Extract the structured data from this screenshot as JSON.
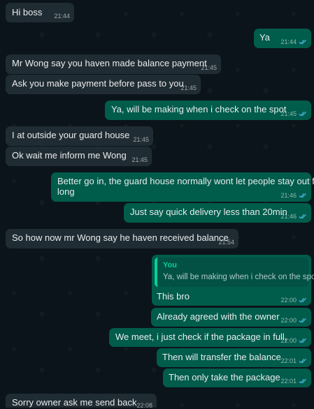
{
  "chat": {
    "messages": [
      {
        "dir": "in",
        "text": "Hi boss",
        "time": "21:44"
      },
      {
        "dir": "out",
        "text": "Ya",
        "time": "21:44",
        "status": "read"
      },
      {
        "dir": "in",
        "text": "Mr Wong say you haven made balance payment",
        "time": "21:45"
      },
      {
        "dir": "in",
        "text": "Ask you make payment before pass to you",
        "time": "21:45"
      },
      {
        "dir": "out",
        "text": "Ya, will be making when i check on the spot",
        "time": "21:45",
        "status": "read"
      },
      {
        "dir": "in",
        "text": "I at outside your guard house",
        "time": "21:45"
      },
      {
        "dir": "in",
        "text": "Ok wait me inform me Wong",
        "time": "21:45"
      },
      {
        "dir": "out",
        "text": "Better go in, the guard house normally wont let people stay out for",
        "text2": "long",
        "time": "21:46",
        "status": "read"
      },
      {
        "dir": "out",
        "text": "Just say quick delivery less than 20min",
        "time": "21:46",
        "status": "read"
      },
      {
        "dir": "in",
        "text": "So how now mr Wong say he haven received balance",
        "time": "21:54"
      },
      {
        "dir": "out",
        "quote_name": "You",
        "quote_text": "Ya, will be making when i check on the spot",
        "text": "This bro",
        "time": "22:00",
        "status": "read"
      },
      {
        "dir": "out",
        "text": "Already agreed with the owner",
        "time": "22:00",
        "status": "read"
      },
      {
        "dir": "out",
        "text": "We meet, i just check if the package in full,",
        "time": "22:00",
        "status": "read"
      },
      {
        "dir": "out",
        "text": "Then will transfer the balance",
        "time": "22:01",
        "status": "read"
      },
      {
        "dir": "out",
        "text": "Then only take the package",
        "time": "22:01",
        "status": "read"
      },
      {
        "dir": "in",
        "text": "Sorry owner ask me send back",
        "time": "22:08"
      }
    ]
  },
  "colors": {
    "background": "#0b141a",
    "incoming_bubble": "#202c33",
    "outgoing_bubble": "#005c4b",
    "read_tick": "#53bdeb",
    "quote_accent": "#06cf9c"
  }
}
